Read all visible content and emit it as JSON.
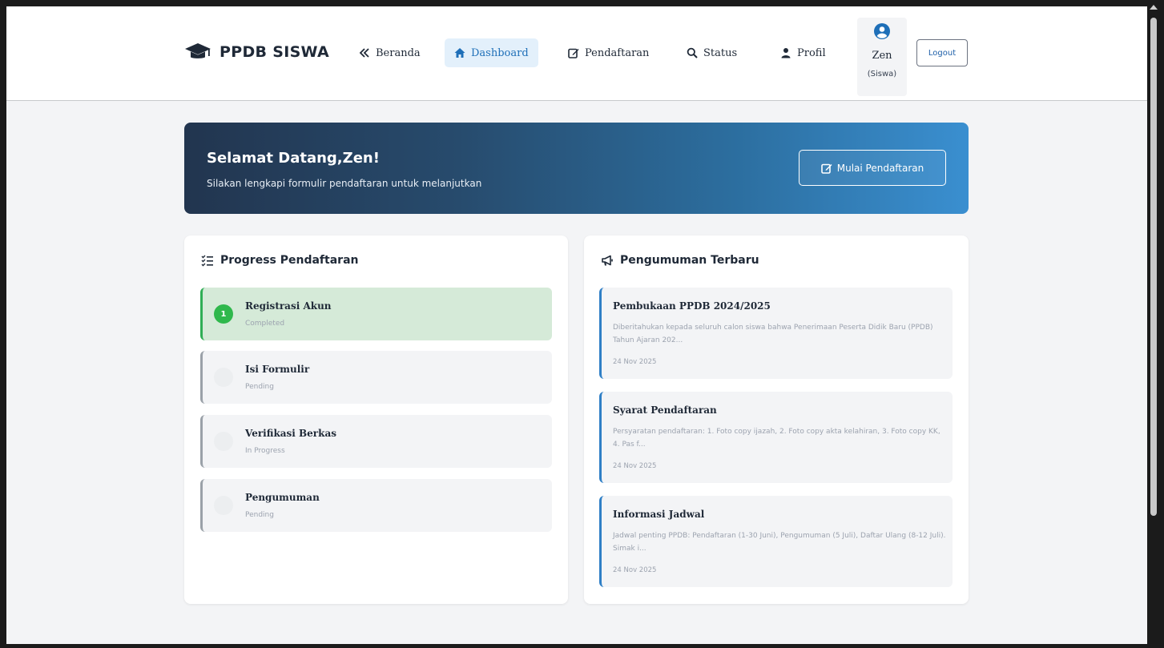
{
  "brand": {
    "title": "PPDB SISWA",
    "icon": "graduation-cap-icon"
  },
  "nav": {
    "items": [
      {
        "label": "Beranda",
        "icon": "double-chevron-left-icon"
      },
      {
        "label": "Dashboard",
        "icon": "home-icon",
        "active": true
      },
      {
        "label": "Pendaftaran",
        "icon": "edit-icon"
      },
      {
        "label": "Status",
        "icon": "search-icon"
      },
      {
        "label": "Profil",
        "icon": "user-icon"
      }
    ]
  },
  "user": {
    "name": "Zen",
    "role": "(Siswa)",
    "icon": "user-circle-icon"
  },
  "logout_label": "Logout",
  "hero": {
    "title": "Selamat Datang,Zen!",
    "subtitle": "Silakan lengkapi formulir pendaftaran untuk melanjutkan",
    "button_label": "Mulai Pendaftaran"
  },
  "progress": {
    "title": "Progress Pendaftaran",
    "steps": [
      {
        "number": "1",
        "name": "Registrasi Akun",
        "status": "Completed",
        "done": true
      },
      {
        "number": "",
        "name": "Isi Formulir",
        "status": "Pending",
        "done": false
      },
      {
        "number": "",
        "name": "Verifikasi Berkas",
        "status": "In Progress",
        "done": false
      },
      {
        "number": "",
        "name": "Pengumuman",
        "status": "Pending",
        "done": false
      }
    ]
  },
  "news": {
    "title": "Pengumuman Terbaru",
    "items": [
      {
        "title": "Pembukaan PPDB 2024/2025",
        "body": "Diberitahukan kepada seluruh calon siswa bahwa Penerimaan Peserta Didik Baru (PPDB) Tahun Ajaran 202...",
        "date": "24 Nov 2025"
      },
      {
        "title": "Syarat Pendaftaran",
        "body": "Persyaratan pendaftaran: 1. Foto copy ijazah, 2. Foto copy akta kelahiran, 3. Foto copy KK, 4. Pas f...",
        "date": "24 Nov 2025"
      },
      {
        "title": "Informasi Jadwal",
        "body": "Jadwal penting PPDB: Pendaftaran (1-30 Juni), Pengumuman (5 Juli), Daftar Ulang (8-12 Juli). Simak i...",
        "date": "24 Nov 2025"
      }
    ]
  },
  "colors": {
    "accent": "#1e6fb8",
    "hero_gradient_start": "#22354f",
    "hero_gradient_end": "#3a8fd0",
    "done_green": "#2fb84c",
    "done_bg": "#d5ead8"
  }
}
